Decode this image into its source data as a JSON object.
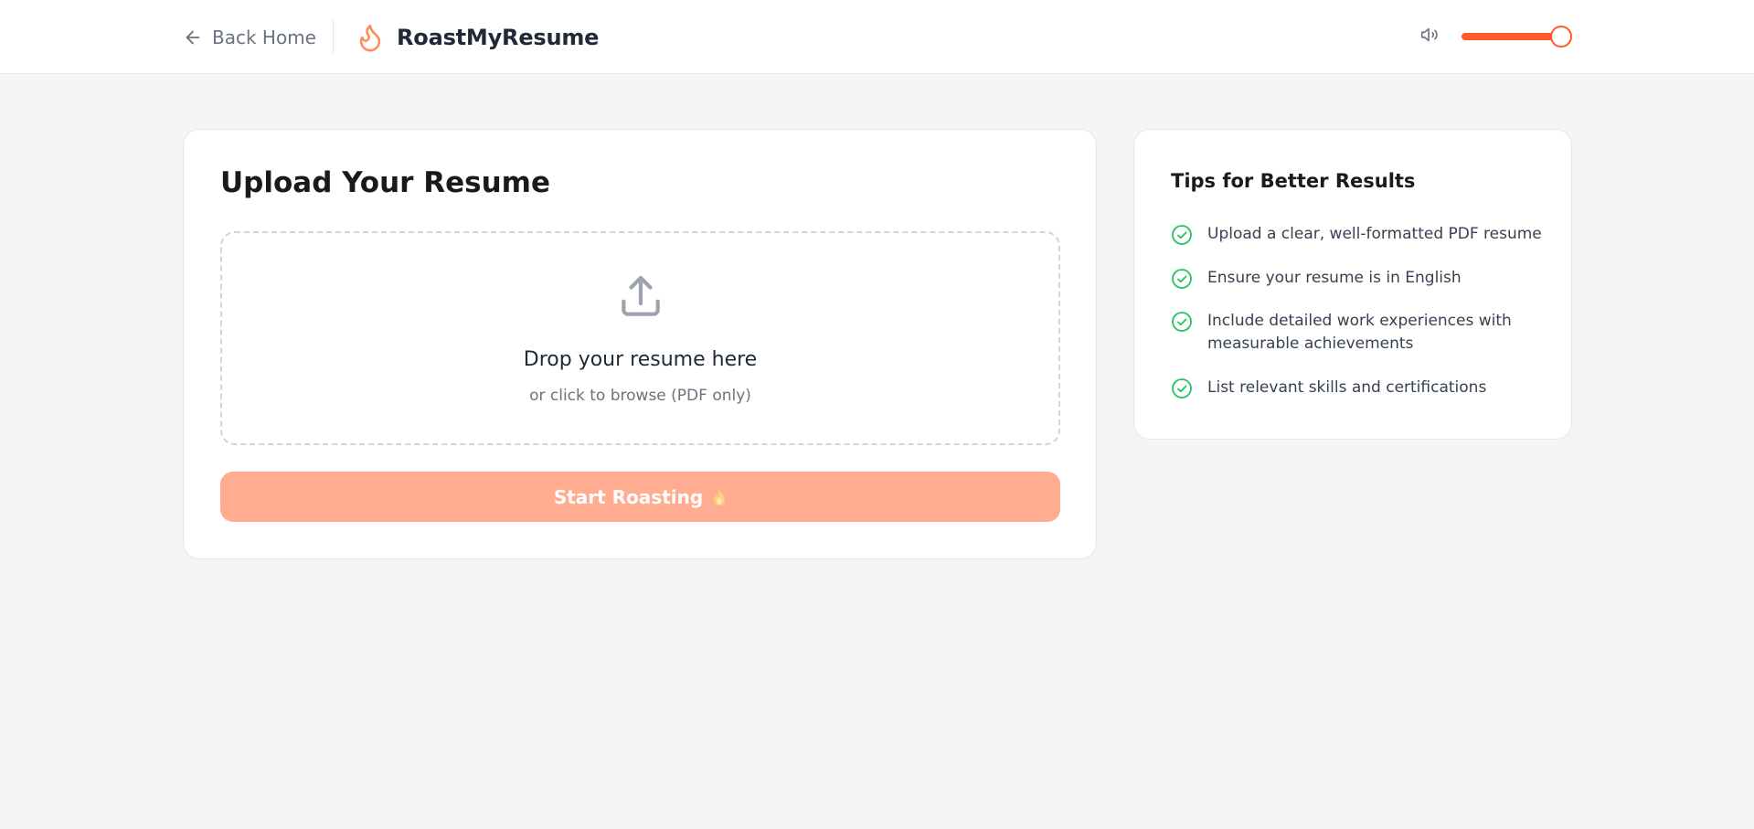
{
  "header": {
    "back_label": "Back Home",
    "brand_name": "RoastMyResume",
    "volume_level": 1.0
  },
  "upload": {
    "title": "Upload Your Resume",
    "drop_title": "Drop your resume here",
    "drop_subtitle": "or click to browse (PDF only)",
    "start_label": "Start Roasting"
  },
  "tips": {
    "title": "Tips for Better Results",
    "items": [
      "Upload a clear, well-formatted PDF resume",
      "Ensure your resume is in English",
      "Include detailed work experiences with measurable achievements",
      "List relevant skills and certifications"
    ]
  },
  "colors": {
    "accent": "#ff5a2c",
    "button_disabled": "#ffac91",
    "check": "#22c55e"
  },
  "icons": {
    "back": "arrow-left-icon",
    "brand": "flame-icon",
    "sound": "speaker-icon",
    "upload": "upload-icon",
    "button": "fire-emoji-icon",
    "tip": "check-circle-icon"
  }
}
